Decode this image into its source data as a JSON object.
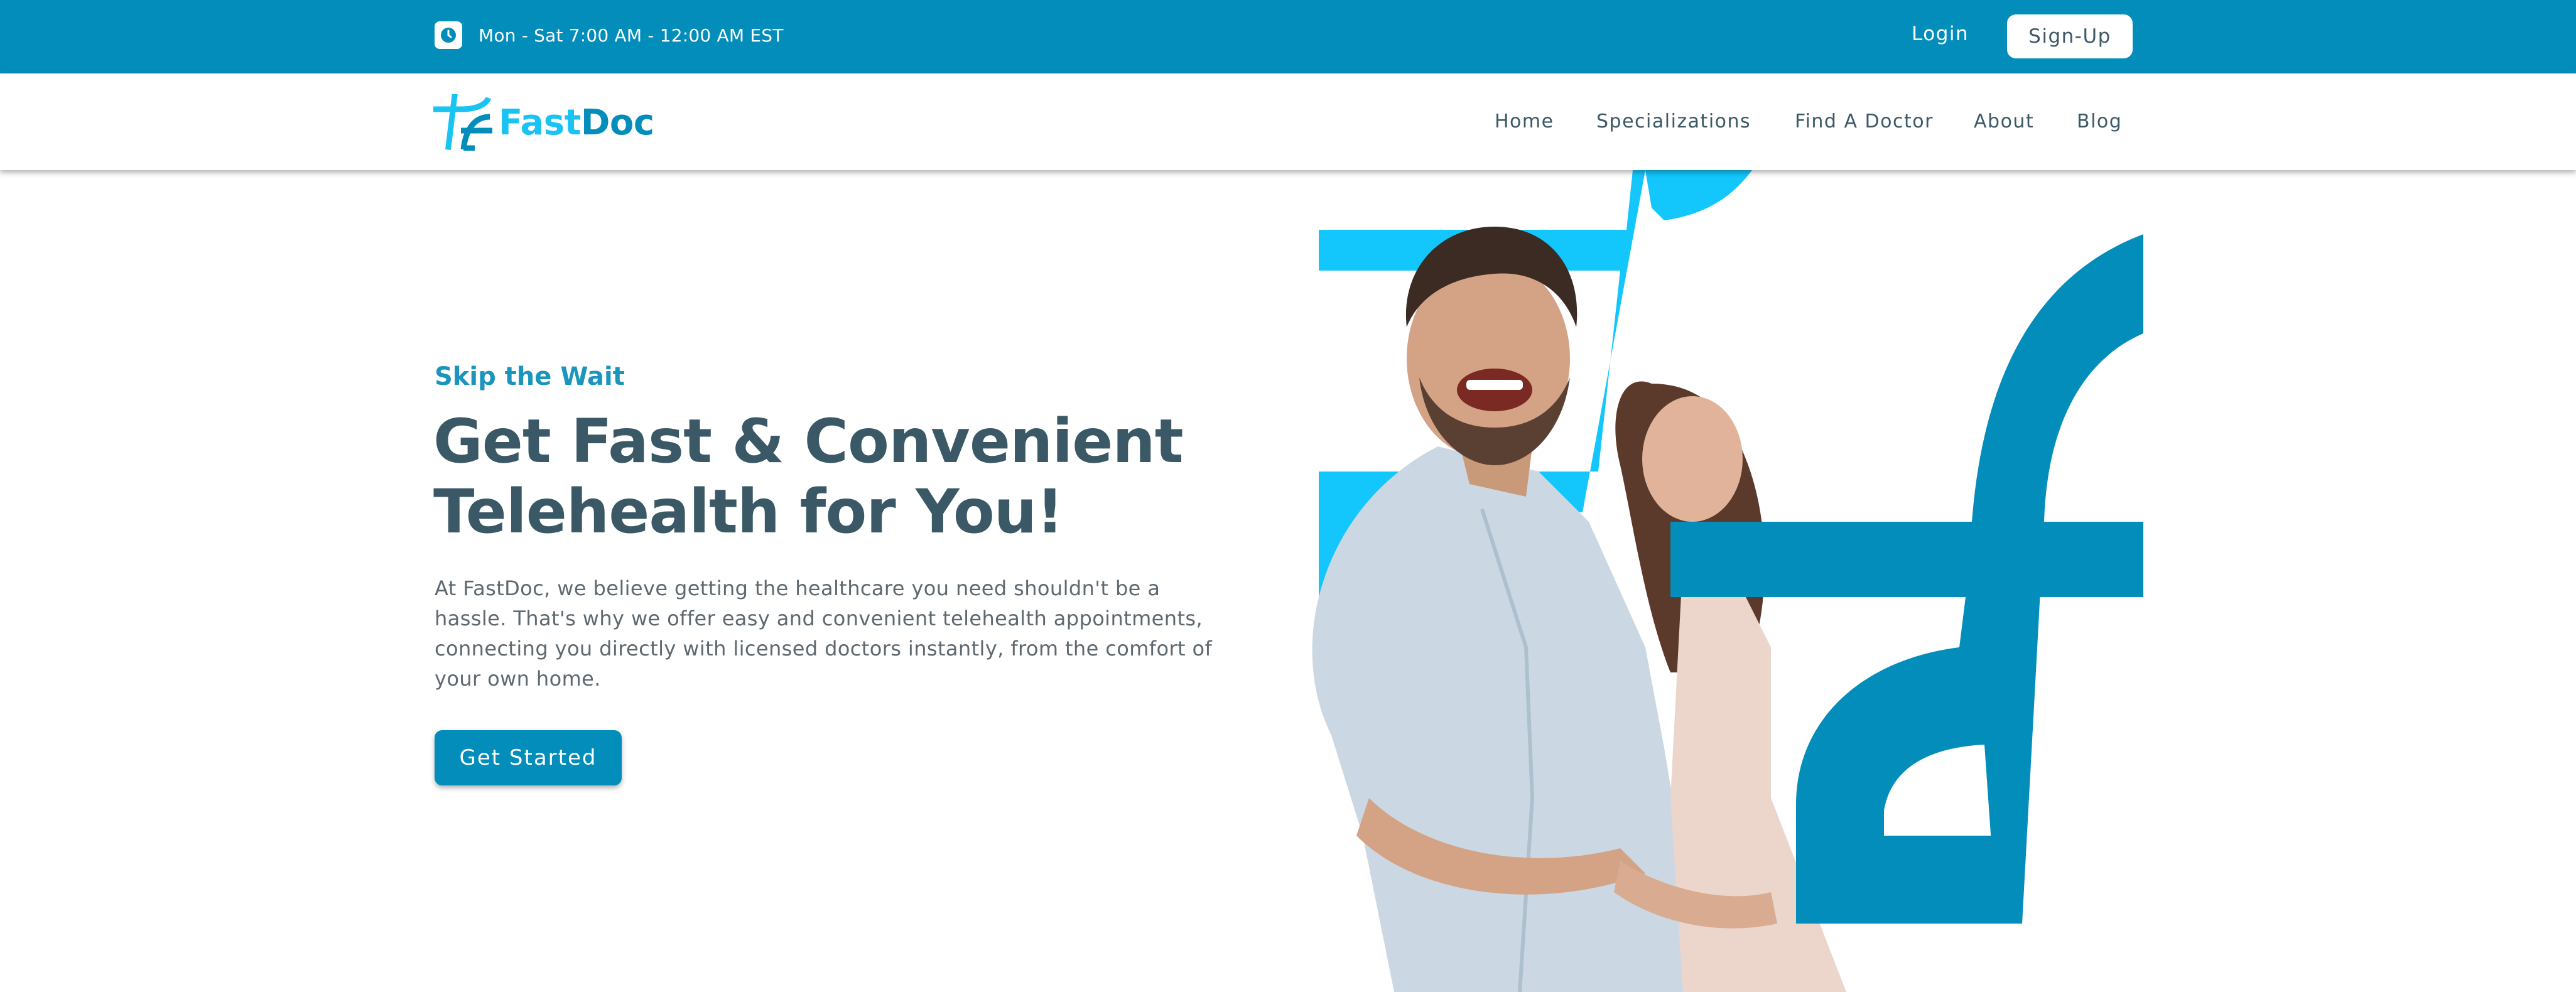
{
  "topbar": {
    "hours_text": "Mon - Sat 7:00 AM - 12:00 AM EST",
    "hours_icon": "clock-icon",
    "login_label": "Login",
    "signup_label": "Sign-Up",
    "background": "#028dbb"
  },
  "brand": {
    "name_part1": "Fast",
    "name_part2": "Doc",
    "logo_icon": "fastdoc-logo-icon",
    "color_light": "#19c3f2",
    "color_dark": "#028dbb"
  },
  "nav": {
    "items": [
      {
        "label": "Home"
      },
      {
        "label": "Specializations"
      },
      {
        "label": "Find A Doctor"
      },
      {
        "label": "About"
      },
      {
        "label": "Blog"
      }
    ]
  },
  "hero": {
    "eyebrow": "Skip the Wait",
    "headline_line1": "Get Fast & Convenient",
    "headline_line2": "Telehealth for You!",
    "desc_line1": "At FastDoc, we believe getting the healthcare you need shouldn't be a",
    "desc_line2": "hassle. That's why we offer easy and convenient telehealth appointments,",
    "desc_line3": "connecting you directly with licensed doctors instantly, from the comfort of",
    "desc_line4": "your own home.",
    "cta_label": "Get Started",
    "image": "smiling-couple-photo"
  }
}
